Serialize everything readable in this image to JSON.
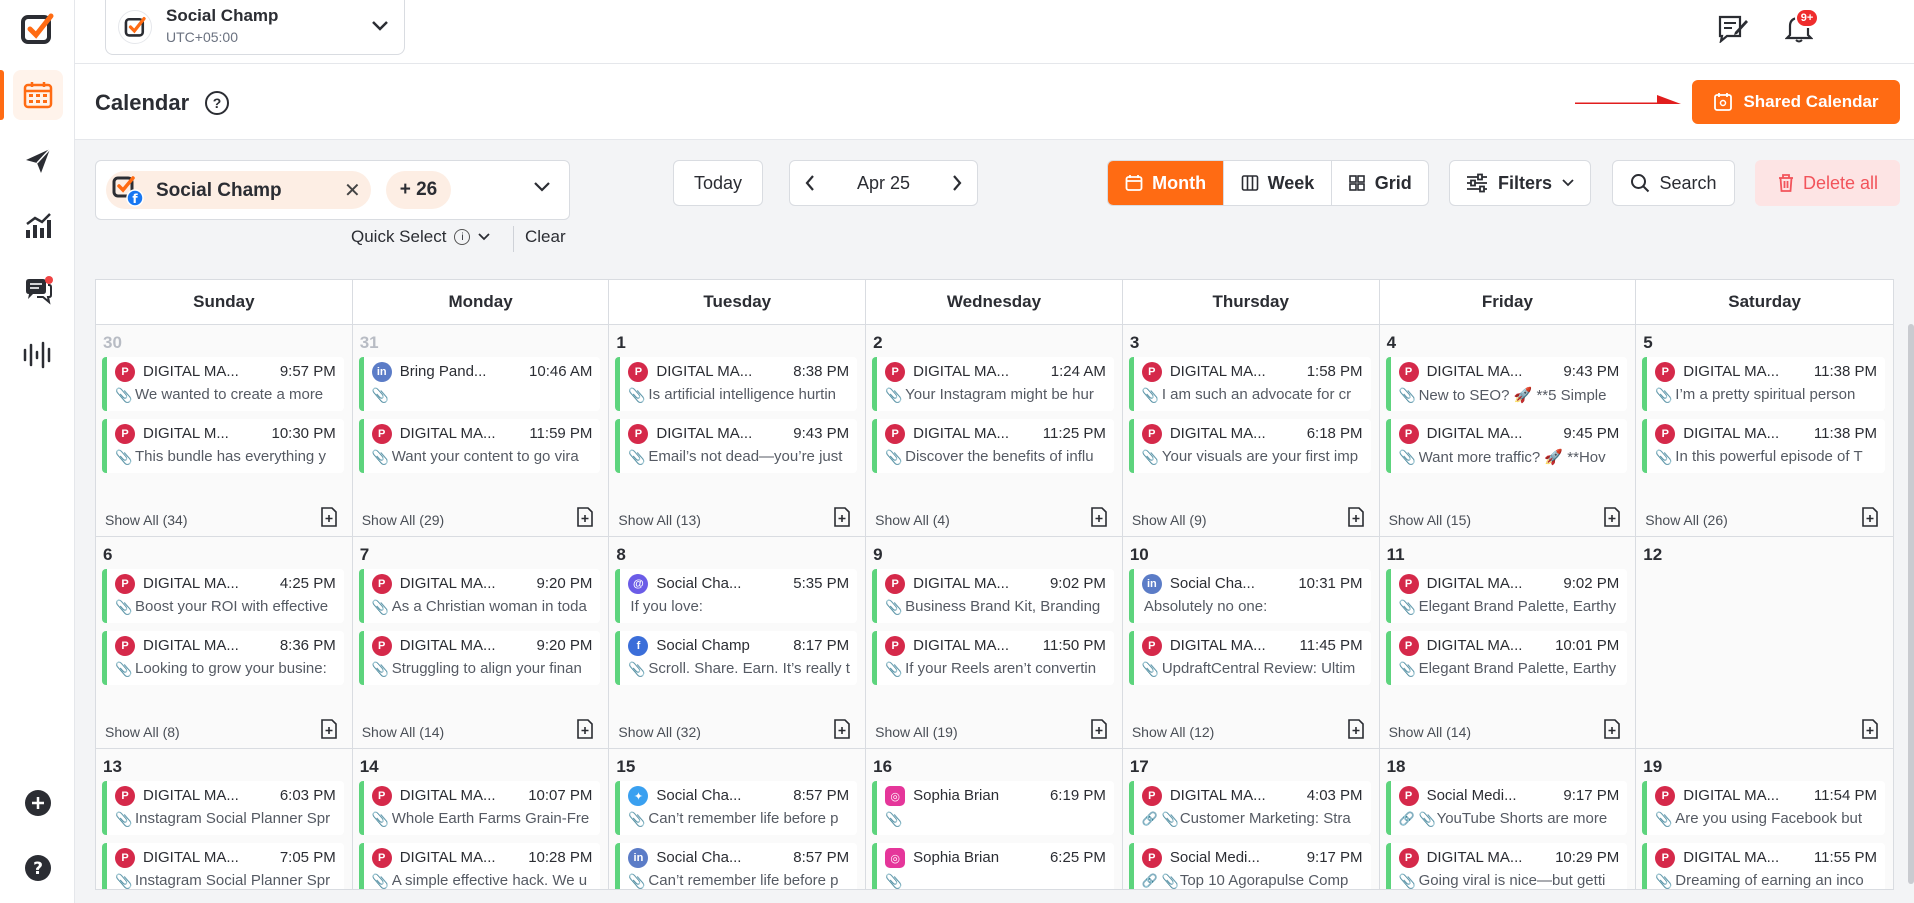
{
  "topbar": {
    "account_name": "Social Champ",
    "timezone": "UTC+05:00",
    "notifications_badge": "9+"
  },
  "header": {
    "title": "Calendar",
    "help": "?",
    "shared_calendar_label": "Shared Calendar"
  },
  "filters": {
    "account_chip": "Social Champ",
    "more_accounts": "+ 26",
    "quick_select": "Quick Select",
    "clear": "Clear",
    "today": "Today",
    "current_period": "Apr 25",
    "views": [
      "Month",
      "Week",
      "Grid"
    ],
    "active_view": "Month",
    "filters_label": "Filters",
    "search_label": "Search",
    "delete_all_label": "Delete all"
  },
  "calendar": {
    "weekdays": [
      "Sunday",
      "Monday",
      "Tuesday",
      "Wednesday",
      "Thursday",
      "Friday",
      "Saturday"
    ],
    "weeks": [
      [
        {
          "day": "30",
          "muted": true,
          "show_all": "Show All (34)",
          "posts": [
            {
              "net": "pin",
              "name": "DIGITAL MA...",
              "time": "9:57 PM",
              "text": "We wanted to create a more"
            },
            {
              "net": "pin",
              "name": "DIGITAL M...",
              "time": "10:30 PM",
              "text": "This bundle has everything y"
            }
          ]
        },
        {
          "day": "31",
          "muted": true,
          "show_all": "Show All (29)",
          "posts": [
            {
              "net": "li",
              "name": "Bring Pand...",
              "time": "10:46 AM",
              "text": ""
            },
            {
              "net": "pin",
              "name": "DIGITAL MA...",
              "time": "11:59 PM",
              "text": "Want your content to go vira"
            }
          ]
        },
        {
          "day": "1",
          "show_all": "Show All (13)",
          "posts": [
            {
              "net": "pin",
              "name": "DIGITAL MA...",
              "time": "8:38 PM",
              "text": "Is artificial intelligence hurtin"
            },
            {
              "net": "pin",
              "name": "DIGITAL MA...",
              "time": "9:43 PM",
              "text": "Email’s not dead—you’re just"
            }
          ]
        },
        {
          "day": "2",
          "show_all": "Show All (4)",
          "posts": [
            {
              "net": "pin",
              "name": "DIGITAL MA...",
              "time": "1:24 AM",
              "text": "Your Instagram might be hur"
            },
            {
              "net": "pin",
              "name": "DIGITAL MA...",
              "time": "11:25 PM",
              "text": "Discover the benefits of influ"
            }
          ]
        },
        {
          "day": "3",
          "show_all": "Show All (9)",
          "posts": [
            {
              "net": "pin",
              "name": "DIGITAL MA...",
              "time": "1:58 PM",
              "text": "I am such an advocate for cr"
            },
            {
              "net": "pin",
              "name": "DIGITAL MA...",
              "time": "6:18 PM",
              "text": "Your visuals are your first imp"
            }
          ]
        },
        {
          "day": "4",
          "show_all": "Show All (15)",
          "posts": [
            {
              "net": "pin",
              "name": "DIGITAL MA...",
              "time": "9:43 PM",
              "text": "New to SEO? 🚀 **5 Simple"
            },
            {
              "net": "pin",
              "name": "DIGITAL MA...",
              "time": "9:45 PM",
              "text": "Want more traffic? 🚀 **Hov"
            }
          ]
        },
        {
          "day": "5",
          "show_all": "Show All (26)",
          "posts": [
            {
              "net": "pin",
              "name": "DIGITAL MA...",
              "time": "11:38 PM",
              "text": "I’m a pretty spiritual person"
            },
            {
              "net": "pin",
              "name": "DIGITAL MA...",
              "time": "11:38 PM",
              "text": "In this powerful episode of T"
            }
          ]
        }
      ],
      [
        {
          "day": "6",
          "show_all": "Show All (8)",
          "posts": [
            {
              "net": "pin",
              "name": "DIGITAL MA...",
              "time": "4:25 PM",
              "text": "Boost your ROI with effective"
            },
            {
              "net": "pin",
              "name": "DIGITAL MA...",
              "time": "8:36 PM",
              "text": "Looking to grow your busine:"
            }
          ]
        },
        {
          "day": "7",
          "show_all": "Show All (14)",
          "posts": [
            {
              "net": "pin",
              "name": "DIGITAL MA...",
              "time": "9:20 PM",
              "text": "As a Christian woman in toda"
            },
            {
              "net": "pin",
              "name": "DIGITAL MA...",
              "time": "9:20 PM",
              "text": "Struggling to align your finan"
            }
          ]
        },
        {
          "day": "8",
          "show_all": "Show All (32)",
          "posts": [
            {
              "net": "ms",
              "name": "Social Cha...",
              "time": "5:35 PM",
              "text": "If you love:",
              "noclip": true
            },
            {
              "net": "fb",
              "name": "Social Champ",
              "time": "8:17 PM",
              "text": "Scroll. Share. Earn. It’s really t"
            }
          ]
        },
        {
          "day": "9",
          "show_all": "Show All (19)",
          "posts": [
            {
              "net": "pin",
              "name": "DIGITAL MA...",
              "time": "9:02 PM",
              "text": "Business Brand Kit, Branding"
            },
            {
              "net": "pin",
              "name": "DIGITAL MA...",
              "time": "11:50 PM",
              "text": "If your Reels aren’t convertin"
            }
          ]
        },
        {
          "day": "10",
          "show_all": "Show All (12)",
          "posts": [
            {
              "net": "li",
              "name": "Social Cha...",
              "time": "10:31 PM",
              "text": "Absolutely no one:",
              "noclip": true
            },
            {
              "net": "pin",
              "name": "DIGITAL MA...",
              "time": "11:45 PM",
              "text": "UpdraftCentral Review: Ultim"
            }
          ]
        },
        {
          "day": "11",
          "show_all": "Show All (14)",
          "posts": [
            {
              "net": "pin",
              "name": "DIGITAL MA...",
              "time": "9:02 PM",
              "text": "Elegant Brand Palette, Earthy"
            },
            {
              "net": "pin",
              "name": "DIGITAL MA...",
              "time": "10:01 PM",
              "text": "Elegant Brand Palette, Earthy"
            }
          ]
        },
        {
          "day": "12",
          "show_all": "",
          "posts": []
        }
      ],
      [
        {
          "day": "13",
          "show_all": "",
          "posts": [
            {
              "net": "pin",
              "name": "DIGITAL MA...",
              "time": "6:03 PM",
              "text": "Instagram Social Planner Spr"
            },
            {
              "net": "pin",
              "name": "DIGITAL MA...",
              "time": "7:05 PM",
              "text": "Instagram Social Planner Spr"
            }
          ]
        },
        {
          "day": "14",
          "show_all": "",
          "posts": [
            {
              "net": "pin",
              "name": "DIGITAL MA...",
              "time": "10:07 PM",
              "text": "Whole Earth Farms Grain-Fre"
            },
            {
              "net": "pin",
              "name": "DIGITAL MA...",
              "time": "10:28 PM",
              "text": "A simple effective hack. We u"
            }
          ]
        },
        {
          "day": "15",
          "show_all": "",
          "posts": [
            {
              "net": "tw",
              "name": "Social Cha...",
              "time": "8:57 PM",
              "text": "Can’t remember life before p"
            },
            {
              "net": "li",
              "name": "Social Cha...",
              "time": "8:57 PM",
              "text": "Can’t remember life before p"
            }
          ]
        },
        {
          "day": "16",
          "show_all": "",
          "posts": [
            {
              "net": "ig",
              "name": "Sophia Brian",
              "time": "6:19 PM",
              "text": ""
            },
            {
              "net": "ig",
              "name": "Sophia Brian",
              "time": "6:25 PM",
              "text": ""
            }
          ]
        },
        {
          "day": "17",
          "show_all": "",
          "posts": [
            {
              "net": "pin",
              "name": "DIGITAL MA...",
              "time": "4:03 PM",
              "text": "Customer Marketing: Stra",
              "link": true
            },
            {
              "net": "pin",
              "name": "Social Medi...",
              "time": "9:17 PM",
              "text": "Top 10 Agorapulse Comp",
              "link": true
            }
          ]
        },
        {
          "day": "18",
          "show_all": "",
          "posts": [
            {
              "net": "pin",
              "name": "Social Medi...",
              "time": "9:17 PM",
              "text": "YouTube Shorts are more",
              "link": true
            },
            {
              "net": "pin",
              "name": "DIGITAL MA...",
              "time": "10:29 PM",
              "text": "Going viral is nice—but getti"
            }
          ]
        },
        {
          "day": "19",
          "show_all": "",
          "posts": [
            {
              "net": "pin",
              "name": "DIGITAL MA...",
              "time": "11:54 PM",
              "text": "Are you using Facebook but"
            },
            {
              "net": "pin",
              "name": "DIGITAL MA...",
              "time": "11:55 PM",
              "text": "Dreaming of earning an inco"
            }
          ]
        }
      ]
    ]
  },
  "colors": {
    "accent": "#ff6b13",
    "post_border": "#5dd47d",
    "delete": "#f2545b"
  }
}
